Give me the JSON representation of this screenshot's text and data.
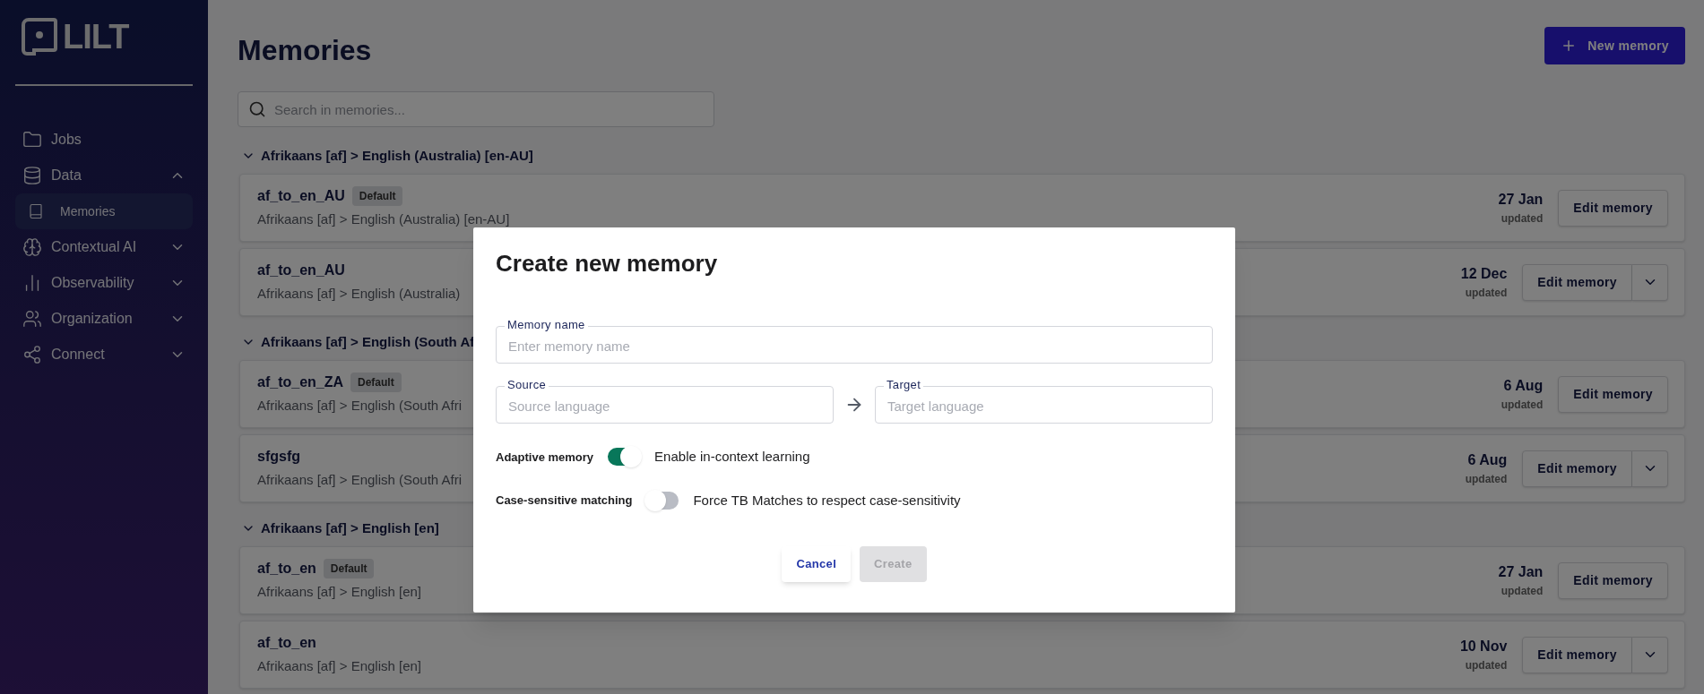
{
  "sidebar": {
    "logo": "LILT",
    "items": [
      {
        "label": "Jobs",
        "kind": "link"
      },
      {
        "label": "Data",
        "kind": "group",
        "expanded": true,
        "children": [
          {
            "label": "Memories",
            "selected": true
          }
        ]
      },
      {
        "label": "Contextual AI",
        "kind": "group",
        "expanded": false
      },
      {
        "label": "Observability",
        "kind": "group",
        "expanded": false
      },
      {
        "label": "Organization",
        "kind": "group",
        "expanded": false
      },
      {
        "label": "Connect",
        "kind": "group",
        "expanded": false
      }
    ]
  },
  "page": {
    "title": "Memories",
    "new_button": "New memory",
    "search": {
      "placeholder": "Search in memories..."
    }
  },
  "groups": [
    {
      "heading": "Afrikaans [af] > English (Australia) [en-AU]",
      "expanded": true,
      "memories": [
        {
          "name": "af_to_en_AU",
          "badge": "Default",
          "languages": "Afrikaans [af] > English (Australia) [en-AU]",
          "date": "27 Jan",
          "date_label": "updated",
          "action": "Edit memory",
          "menu": false
        },
        {
          "name": "af_to_en_AU",
          "languages": "Afrikaans [af] > English (Australia)",
          "date": "12 Dec",
          "date_label": "updated",
          "action": "Edit memory",
          "menu": true
        }
      ]
    },
    {
      "heading": "Afrikaans [af] > English (South Af",
      "expanded": true,
      "memories": [
        {
          "name": "af_to_en_ZA",
          "badge": "Default",
          "languages": "Afrikaans [af] > English (South Afri",
          "date": "6 Aug",
          "date_label": "updated",
          "action": "Edit memory",
          "menu": false
        },
        {
          "name": "sfgsfg",
          "languages": "Afrikaans [af] > English (South Afri",
          "date": "6 Aug",
          "date_label": "updated",
          "action": "Edit memory",
          "menu": true
        }
      ]
    },
    {
      "heading": "Afrikaans [af] > English [en]",
      "expanded": true,
      "memories": [
        {
          "name": "af_to_en",
          "badge": "Default",
          "languages": "Afrikaans [af] > English [en]",
          "date": "27 Jan",
          "date_label": "updated",
          "action": "Edit memory",
          "menu": false
        },
        {
          "name": "af_to_en",
          "languages": "Afrikaans [af] > English [en]",
          "date": "10 Nov",
          "date_label": "updated",
          "action": "Edit memory",
          "menu": true
        }
      ]
    }
  ],
  "dialog": {
    "title": "Create new memory",
    "name_field": {
      "label": "Memory name",
      "placeholder": "Enter memory name"
    },
    "source_field": {
      "label": "Source",
      "placeholder": "Source language"
    },
    "target_field": {
      "label": "Target",
      "placeholder": "Target language"
    },
    "toggles": [
      {
        "label": "Adaptive memory",
        "description": "Enable in-context learning",
        "on": true
      },
      {
        "label": "Case-sensitive matching",
        "description": "Force TB Matches to respect case-sensitivity",
        "on": false
      }
    ],
    "cancel": "Cancel",
    "create": {
      "label": "Create",
      "disabled": true
    }
  }
}
